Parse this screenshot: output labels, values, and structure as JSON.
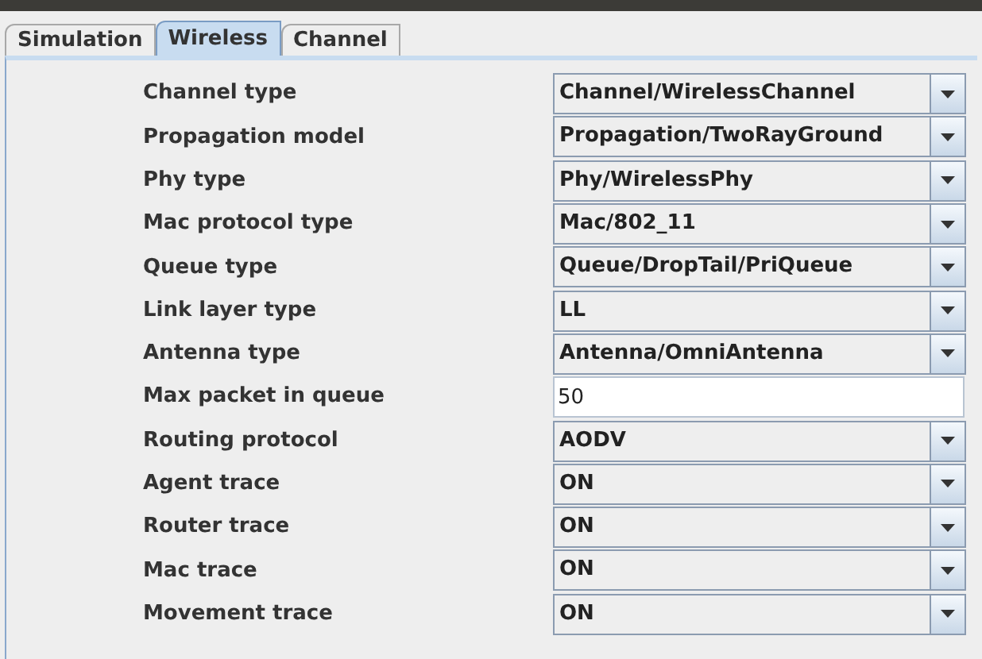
{
  "tabs": [
    {
      "label": "Simulation",
      "selected": false
    },
    {
      "label": "Wireless",
      "selected": true
    },
    {
      "label": "Channel",
      "selected": false
    }
  ],
  "fields": [
    {
      "label": "Channel type",
      "kind": "dropdown",
      "value": "Channel/WirelessChannel"
    },
    {
      "label": "Propagation model",
      "kind": "dropdown",
      "value": "Propagation/TwoRayGround"
    },
    {
      "label": "Phy type",
      "kind": "dropdown",
      "value": "Phy/WirelessPhy"
    },
    {
      "label": "Mac protocol type",
      "kind": "dropdown",
      "value": "Mac/802_11"
    },
    {
      "label": "Queue type",
      "kind": "dropdown",
      "value": "Queue/DropTail/PriQueue"
    },
    {
      "label": "Link layer type",
      "kind": "dropdown",
      "value": "LL"
    },
    {
      "label": "Antenna type",
      "kind": "dropdown",
      "value": "Antenna/OmniAntenna"
    },
    {
      "label": "Max packet in queue",
      "kind": "text",
      "value": "50"
    },
    {
      "label": "Routing protocol",
      "kind": "dropdown",
      "value": "AODV"
    },
    {
      "label": "Agent trace",
      "kind": "dropdown",
      "value": "ON"
    },
    {
      "label": "Router trace",
      "kind": "dropdown",
      "value": "ON"
    },
    {
      "label": "Mac trace",
      "kind": "dropdown",
      "value": "ON"
    },
    {
      "label": "Movement trace",
      "kind": "dropdown",
      "value": "ON"
    }
  ]
}
